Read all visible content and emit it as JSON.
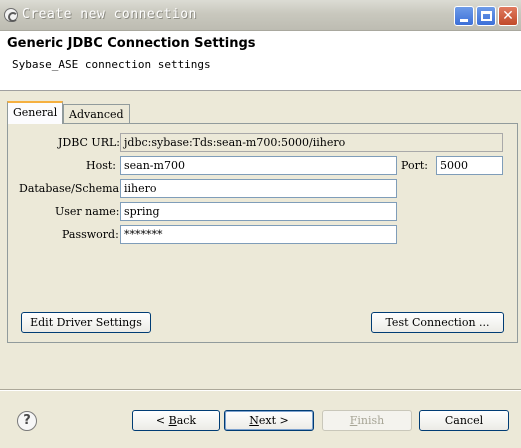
{
  "window": {
    "title": "Create new connection",
    "icons": {
      "app": "eclipse-app-icon",
      "minimize": "minimize-icon",
      "maximize": "maximize-icon",
      "close": "close-icon"
    }
  },
  "header": {
    "title": "Generic JDBC Connection Settings",
    "subtitle": "Sybase_ASE connection settings"
  },
  "tabs": [
    {
      "label": "General",
      "active": true
    },
    {
      "label": "Advanced",
      "active": false
    }
  ],
  "form": {
    "jdbc_url": {
      "label": "JDBC URL:",
      "value": "jdbc:sybase:Tds:sean-m700:5000/iihero"
    },
    "host": {
      "label": "Host:",
      "value": "sean-m700"
    },
    "port": {
      "label": "Port:",
      "value": "5000"
    },
    "database": {
      "label": "Database/Schema:",
      "value": "iihero"
    },
    "user": {
      "label": "User name:",
      "value": "spring"
    },
    "password": {
      "label": "Password:",
      "value": "*******"
    }
  },
  "panel_buttons": {
    "edit_driver": "Edit Driver Settings",
    "test_connection": "Test Connection ..."
  },
  "footer": {
    "help_icon": "help-icon",
    "back": {
      "arrow": "<",
      "mnemonic": "B",
      "rest": "ack"
    },
    "next": {
      "mnemonic": "N",
      "rest": "ext",
      "arrow": ">"
    },
    "finish": {
      "mnemonic": "F",
      "rest": "inish",
      "enabled": false
    },
    "cancel": "Cancel"
  }
}
